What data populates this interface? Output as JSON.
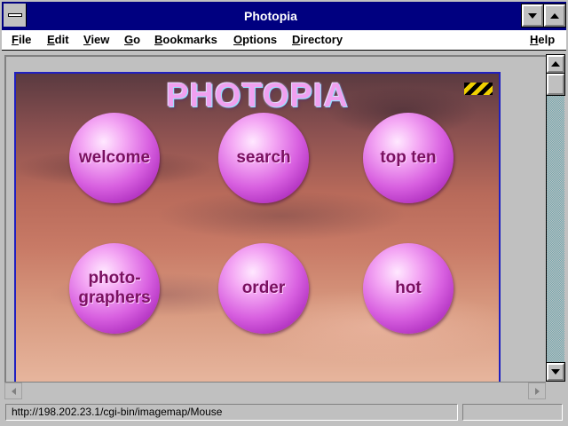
{
  "window": {
    "title": "Photopia"
  },
  "menu": {
    "items": [
      {
        "label": "File"
      },
      {
        "label": "Edit"
      },
      {
        "label": "View"
      },
      {
        "label": "Go"
      },
      {
        "label": "Bookmarks"
      },
      {
        "label": "Options"
      },
      {
        "label": "Directory"
      },
      {
        "label": "Help"
      }
    ]
  },
  "page": {
    "logo": "PHOTOPIA",
    "buttons": [
      {
        "label": "welcome"
      },
      {
        "label": "search"
      },
      {
        "label": "top ten"
      },
      {
        "label": "photo-\ngraphers"
      },
      {
        "label": "order"
      },
      {
        "label": "hot"
      }
    ]
  },
  "status": {
    "text": "http://198.202.23.1/cgi-bin/imagemap/Mouse"
  },
  "icons": {
    "system_menu": "system-menu-icon",
    "minimize": "minimize-icon",
    "maximize": "maximize-icon",
    "scroll_up": "scroll-up-icon",
    "scroll_down": "scroll-down-icon",
    "scroll_left": "scroll-left-icon",
    "scroll_right": "scroll-right-icon",
    "activity": "hazard-stripe-icon"
  },
  "colors": {
    "titlebar": "#000080",
    "bubble": "#d860e0",
    "bubble_text": "#7a1060",
    "imagemap_border": "#2020c0"
  }
}
